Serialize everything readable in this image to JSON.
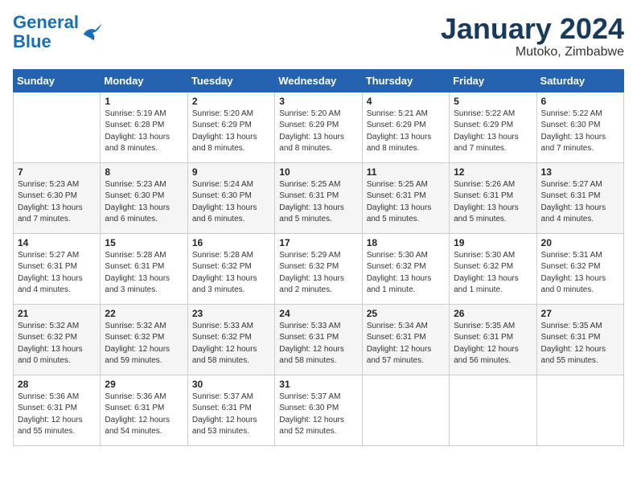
{
  "header": {
    "logo_line1": "General",
    "logo_line2": "Blue",
    "month_title": "January 2024",
    "location": "Mutoko, Zimbabwe"
  },
  "days_of_week": [
    "Sunday",
    "Monday",
    "Tuesday",
    "Wednesday",
    "Thursday",
    "Friday",
    "Saturday"
  ],
  "weeks": [
    [
      {
        "num": "",
        "info": ""
      },
      {
        "num": "1",
        "info": "Sunrise: 5:19 AM\nSunset: 6:28 PM\nDaylight: 13 hours\nand 8 minutes."
      },
      {
        "num": "2",
        "info": "Sunrise: 5:20 AM\nSunset: 6:29 PM\nDaylight: 13 hours\nand 8 minutes."
      },
      {
        "num": "3",
        "info": "Sunrise: 5:20 AM\nSunset: 6:29 PM\nDaylight: 13 hours\nand 8 minutes."
      },
      {
        "num": "4",
        "info": "Sunrise: 5:21 AM\nSunset: 6:29 PM\nDaylight: 13 hours\nand 8 minutes."
      },
      {
        "num": "5",
        "info": "Sunrise: 5:22 AM\nSunset: 6:29 PM\nDaylight: 13 hours\nand 7 minutes."
      },
      {
        "num": "6",
        "info": "Sunrise: 5:22 AM\nSunset: 6:30 PM\nDaylight: 13 hours\nand 7 minutes."
      }
    ],
    [
      {
        "num": "7",
        "info": "Sunrise: 5:23 AM\nSunset: 6:30 PM\nDaylight: 13 hours\nand 7 minutes."
      },
      {
        "num": "8",
        "info": "Sunrise: 5:23 AM\nSunset: 6:30 PM\nDaylight: 13 hours\nand 6 minutes."
      },
      {
        "num": "9",
        "info": "Sunrise: 5:24 AM\nSunset: 6:30 PM\nDaylight: 13 hours\nand 6 minutes."
      },
      {
        "num": "10",
        "info": "Sunrise: 5:25 AM\nSunset: 6:31 PM\nDaylight: 13 hours\nand 5 minutes."
      },
      {
        "num": "11",
        "info": "Sunrise: 5:25 AM\nSunset: 6:31 PM\nDaylight: 13 hours\nand 5 minutes."
      },
      {
        "num": "12",
        "info": "Sunrise: 5:26 AM\nSunset: 6:31 PM\nDaylight: 13 hours\nand 5 minutes."
      },
      {
        "num": "13",
        "info": "Sunrise: 5:27 AM\nSunset: 6:31 PM\nDaylight: 13 hours\nand 4 minutes."
      }
    ],
    [
      {
        "num": "14",
        "info": "Sunrise: 5:27 AM\nSunset: 6:31 PM\nDaylight: 13 hours\nand 4 minutes."
      },
      {
        "num": "15",
        "info": "Sunrise: 5:28 AM\nSunset: 6:31 PM\nDaylight: 13 hours\nand 3 minutes."
      },
      {
        "num": "16",
        "info": "Sunrise: 5:28 AM\nSunset: 6:32 PM\nDaylight: 13 hours\nand 3 minutes."
      },
      {
        "num": "17",
        "info": "Sunrise: 5:29 AM\nSunset: 6:32 PM\nDaylight: 13 hours\nand 2 minutes."
      },
      {
        "num": "18",
        "info": "Sunrise: 5:30 AM\nSunset: 6:32 PM\nDaylight: 13 hours\nand 1 minute."
      },
      {
        "num": "19",
        "info": "Sunrise: 5:30 AM\nSunset: 6:32 PM\nDaylight: 13 hours\nand 1 minute."
      },
      {
        "num": "20",
        "info": "Sunrise: 5:31 AM\nSunset: 6:32 PM\nDaylight: 13 hours\nand 0 minutes."
      }
    ],
    [
      {
        "num": "21",
        "info": "Sunrise: 5:32 AM\nSunset: 6:32 PM\nDaylight: 13 hours\nand 0 minutes."
      },
      {
        "num": "22",
        "info": "Sunrise: 5:32 AM\nSunset: 6:32 PM\nDaylight: 12 hours\nand 59 minutes."
      },
      {
        "num": "23",
        "info": "Sunrise: 5:33 AM\nSunset: 6:32 PM\nDaylight: 12 hours\nand 58 minutes."
      },
      {
        "num": "24",
        "info": "Sunrise: 5:33 AM\nSunset: 6:31 PM\nDaylight: 12 hours\nand 58 minutes."
      },
      {
        "num": "25",
        "info": "Sunrise: 5:34 AM\nSunset: 6:31 PM\nDaylight: 12 hours\nand 57 minutes."
      },
      {
        "num": "26",
        "info": "Sunrise: 5:35 AM\nSunset: 6:31 PM\nDaylight: 12 hours\nand 56 minutes."
      },
      {
        "num": "27",
        "info": "Sunrise: 5:35 AM\nSunset: 6:31 PM\nDaylight: 12 hours\nand 55 minutes."
      }
    ],
    [
      {
        "num": "28",
        "info": "Sunrise: 5:36 AM\nSunset: 6:31 PM\nDaylight: 12 hours\nand 55 minutes."
      },
      {
        "num": "29",
        "info": "Sunrise: 5:36 AM\nSunset: 6:31 PM\nDaylight: 12 hours\nand 54 minutes."
      },
      {
        "num": "30",
        "info": "Sunrise: 5:37 AM\nSunset: 6:31 PM\nDaylight: 12 hours\nand 53 minutes."
      },
      {
        "num": "31",
        "info": "Sunrise: 5:37 AM\nSunset: 6:30 PM\nDaylight: 12 hours\nand 52 minutes."
      },
      {
        "num": "",
        "info": ""
      },
      {
        "num": "",
        "info": ""
      },
      {
        "num": "",
        "info": ""
      }
    ]
  ]
}
